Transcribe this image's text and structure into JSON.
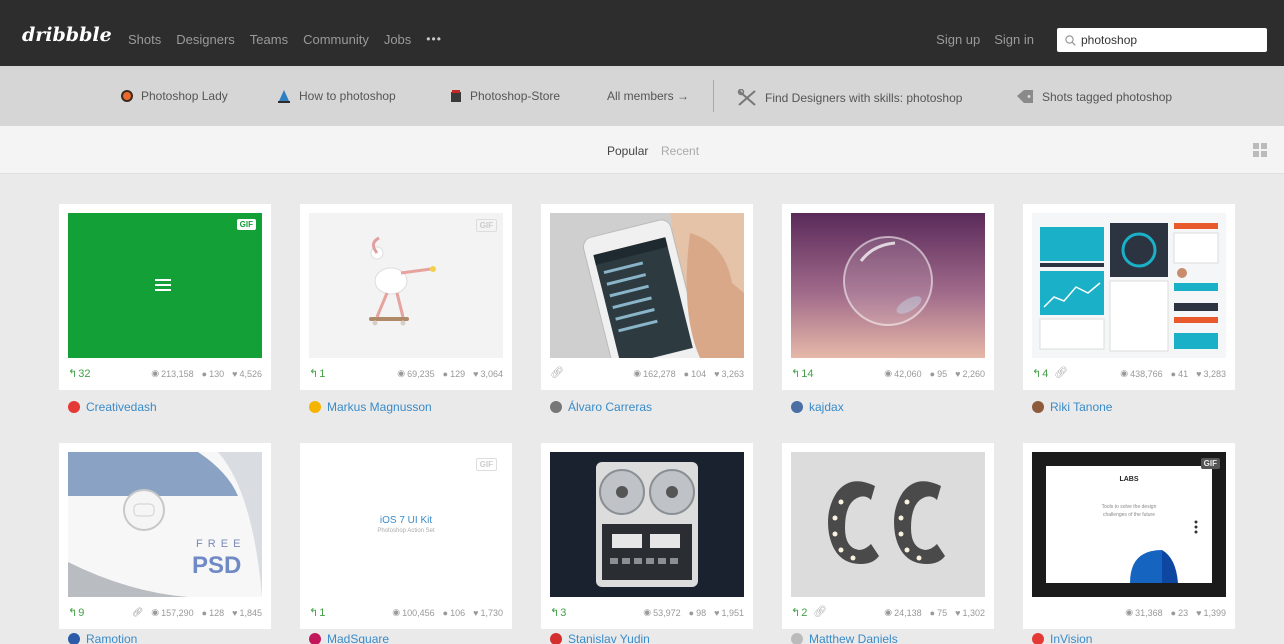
{
  "header": {
    "logo": "dribbble",
    "nav": [
      "Shots",
      "Designers",
      "Teams",
      "Community",
      "Jobs"
    ],
    "more": "•••",
    "signup": "Sign up",
    "signin": "Sign in",
    "search_value": "photoshop"
  },
  "tags": {
    "lady": "Photoshop Lady",
    "how": "How to photoshop",
    "store": "Photoshop-Store",
    "members": "All members →",
    "find": "Find Designers with skills: photoshop",
    "tagged": "Shots tagged photoshop"
  },
  "tabs": {
    "popular": "Popular",
    "recent": "Recent"
  },
  "shots": [
    {
      "rebounds": "32",
      "views": "213,158",
      "comments": "130",
      "likes": "4,526",
      "author": "Creativedash",
      "gif": "GIF"
    },
    {
      "rebounds": "1",
      "views": "69,235",
      "comments": "129",
      "likes": "3,064",
      "author": "Markus Magnusson",
      "gif": "GIF"
    },
    {
      "rebounds": "",
      "views": "162,278",
      "comments": "104",
      "likes": "3,263",
      "author": "Álvaro Carreras",
      "gif": ""
    },
    {
      "rebounds": "14",
      "views": "42,060",
      "comments": "95",
      "likes": "2,260",
      "author": "kajdax",
      "gif": ""
    },
    {
      "rebounds": "4",
      "views": "438,766",
      "comments": "41",
      "likes": "3,283",
      "author": "Riki Tanone",
      "gif": ""
    },
    {
      "rebounds": "9",
      "views": "157,290",
      "comments": "128",
      "likes": "1,845",
      "author": "Ramotion",
      "gif": "",
      "thumb_text": [
        "F R E E",
        "PSD"
      ]
    },
    {
      "rebounds": "1",
      "views": "100,456",
      "comments": "106",
      "likes": "1,730",
      "author": "MadSquare",
      "gif": "GIF",
      "thumb_text": [
        "iOS 7 UI Kit",
        "Photoshop Action Set"
      ]
    },
    {
      "rebounds": "3",
      "views": "53,972",
      "comments": "98",
      "likes": "1,951",
      "author": "Stanislav Yudin",
      "gif": ""
    },
    {
      "rebounds": "2",
      "views": "24,138",
      "comments": "75",
      "likes": "1,302",
      "author": "Matthew Daniels",
      "gif": ""
    },
    {
      "rebounds": "",
      "views": "31,368",
      "comments": "23",
      "likes": "1,399",
      "author": "InVision",
      "gif": "GIF",
      "thumb_text": [
        "LABS",
        "Tools to solve the design",
        "challenges of the future"
      ]
    }
  ],
  "colors": {
    "topbar": "#2d2d2d",
    "tagbar": "#d6d6d6",
    "link": "#3a8bc8",
    "rebound": "#43a047",
    "page": "#eaeaea"
  }
}
